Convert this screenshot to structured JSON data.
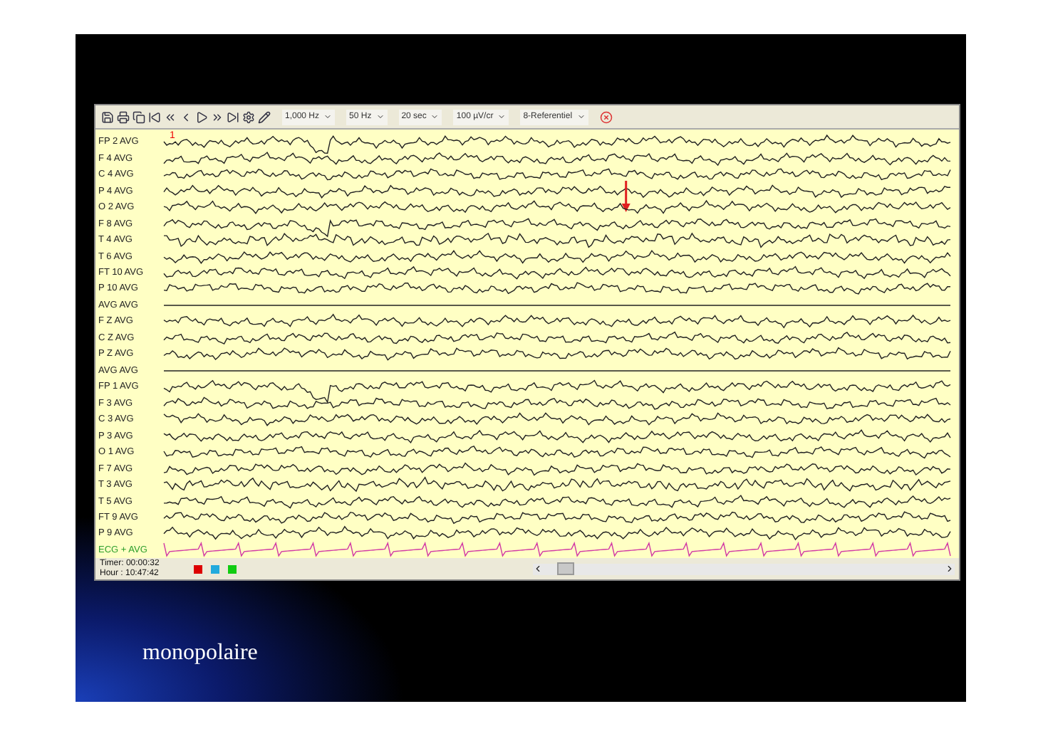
{
  "slide": {
    "title": "monopolaire"
  },
  "toolbar": {
    "dropdowns": [
      "1,000 Hz",
      "50 Hz",
      "20 sec",
      "100 µV/cr",
      "8-Referentiel"
    ]
  },
  "channels": [
    {
      "name": "FP 2 AVG",
      "kind": "eeg",
      "marker": "1"
    },
    {
      "name": "F 4 AVG",
      "kind": "eeg"
    },
    {
      "name": "C 4 AVG",
      "kind": "eeg"
    },
    {
      "name": "P 4 AVG",
      "kind": "eeg"
    },
    {
      "name": "O 2 AVG",
      "kind": "eeg"
    },
    {
      "name": "F 8 AVG",
      "kind": "eeg"
    },
    {
      "name": "T 4 AVG",
      "kind": "eeg"
    },
    {
      "name": "T 6 AVG",
      "kind": "eeg"
    },
    {
      "name": "FT 10 AVG",
      "kind": "eeg"
    },
    {
      "name": "P 10 AVG",
      "kind": "eeg"
    },
    {
      "name": "AVG AVG",
      "kind": "flat"
    },
    {
      "name": "F Z AVG",
      "kind": "eeg"
    },
    {
      "name": "C Z AVG",
      "kind": "eeg"
    },
    {
      "name": "P Z AVG",
      "kind": "eeg"
    },
    {
      "name": "AVG AVG",
      "kind": "flat"
    },
    {
      "name": "FP 1 AVG",
      "kind": "eeg"
    },
    {
      "name": "F 3 AVG",
      "kind": "eeg"
    },
    {
      "name": "C 3 AVG",
      "kind": "eeg"
    },
    {
      "name": "P 3 AVG",
      "kind": "eeg"
    },
    {
      "name": "O 1 AVG",
      "kind": "eeg"
    },
    {
      "name": "F 7 AVG",
      "kind": "eeg"
    },
    {
      "name": "T 3 AVG",
      "kind": "eeg"
    },
    {
      "name": "T 5 AVG",
      "kind": "eeg"
    },
    {
      "name": "FT 9 AVG",
      "kind": "eeg"
    },
    {
      "name": "P 9 AVG",
      "kind": "eeg"
    },
    {
      "name": "ECG + AVG",
      "kind": "ecg"
    }
  ],
  "status_bar": {
    "timer": "Timer: 00:00:32",
    "hour": "Hour : 10:47:42"
  }
}
